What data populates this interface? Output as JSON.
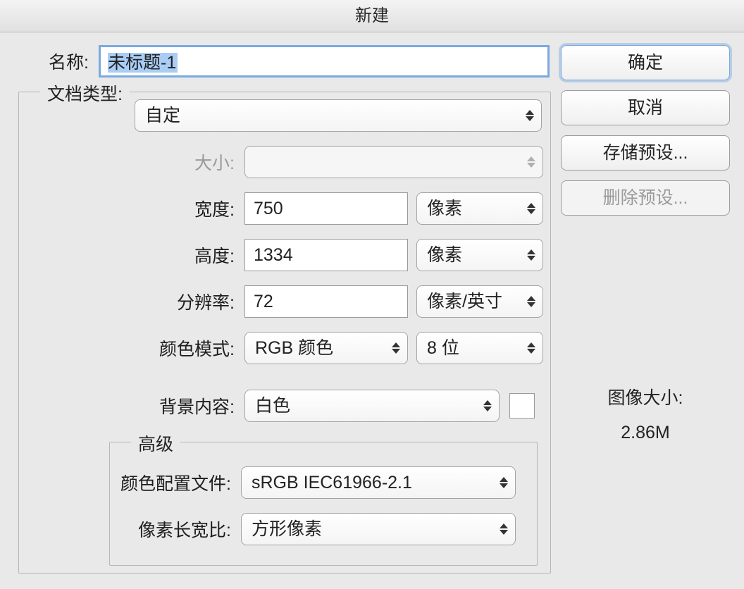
{
  "title": "新建",
  "labels": {
    "name": "名称:",
    "doctype": "文档类型:",
    "size": "大小:",
    "width": "宽度:",
    "height": "高度:",
    "resolution": "分辨率:",
    "colormode": "颜色模式:",
    "bgcontent": "背景内容:",
    "advanced": "高级",
    "profile": "颜色配置文件:",
    "aspect": "像素长宽比:",
    "imagesize": "图像大小:"
  },
  "values": {
    "name": "未标题-1",
    "doctype": "自定",
    "size": "",
    "width": "750",
    "width_unit": "像素",
    "height": "1334",
    "height_unit": "像素",
    "resolution": "72",
    "resolution_unit": "像素/英寸",
    "colormode": "RGB 颜色",
    "bitdepth": "8 位",
    "bgcontent": "白色",
    "profile": "sRGB IEC61966-2.1",
    "aspect": "方形像素",
    "imagesize": "2.86M"
  },
  "buttons": {
    "ok": "确定",
    "cancel": "取消",
    "save_preset": "存储预设...",
    "delete_preset": "删除预设..."
  }
}
